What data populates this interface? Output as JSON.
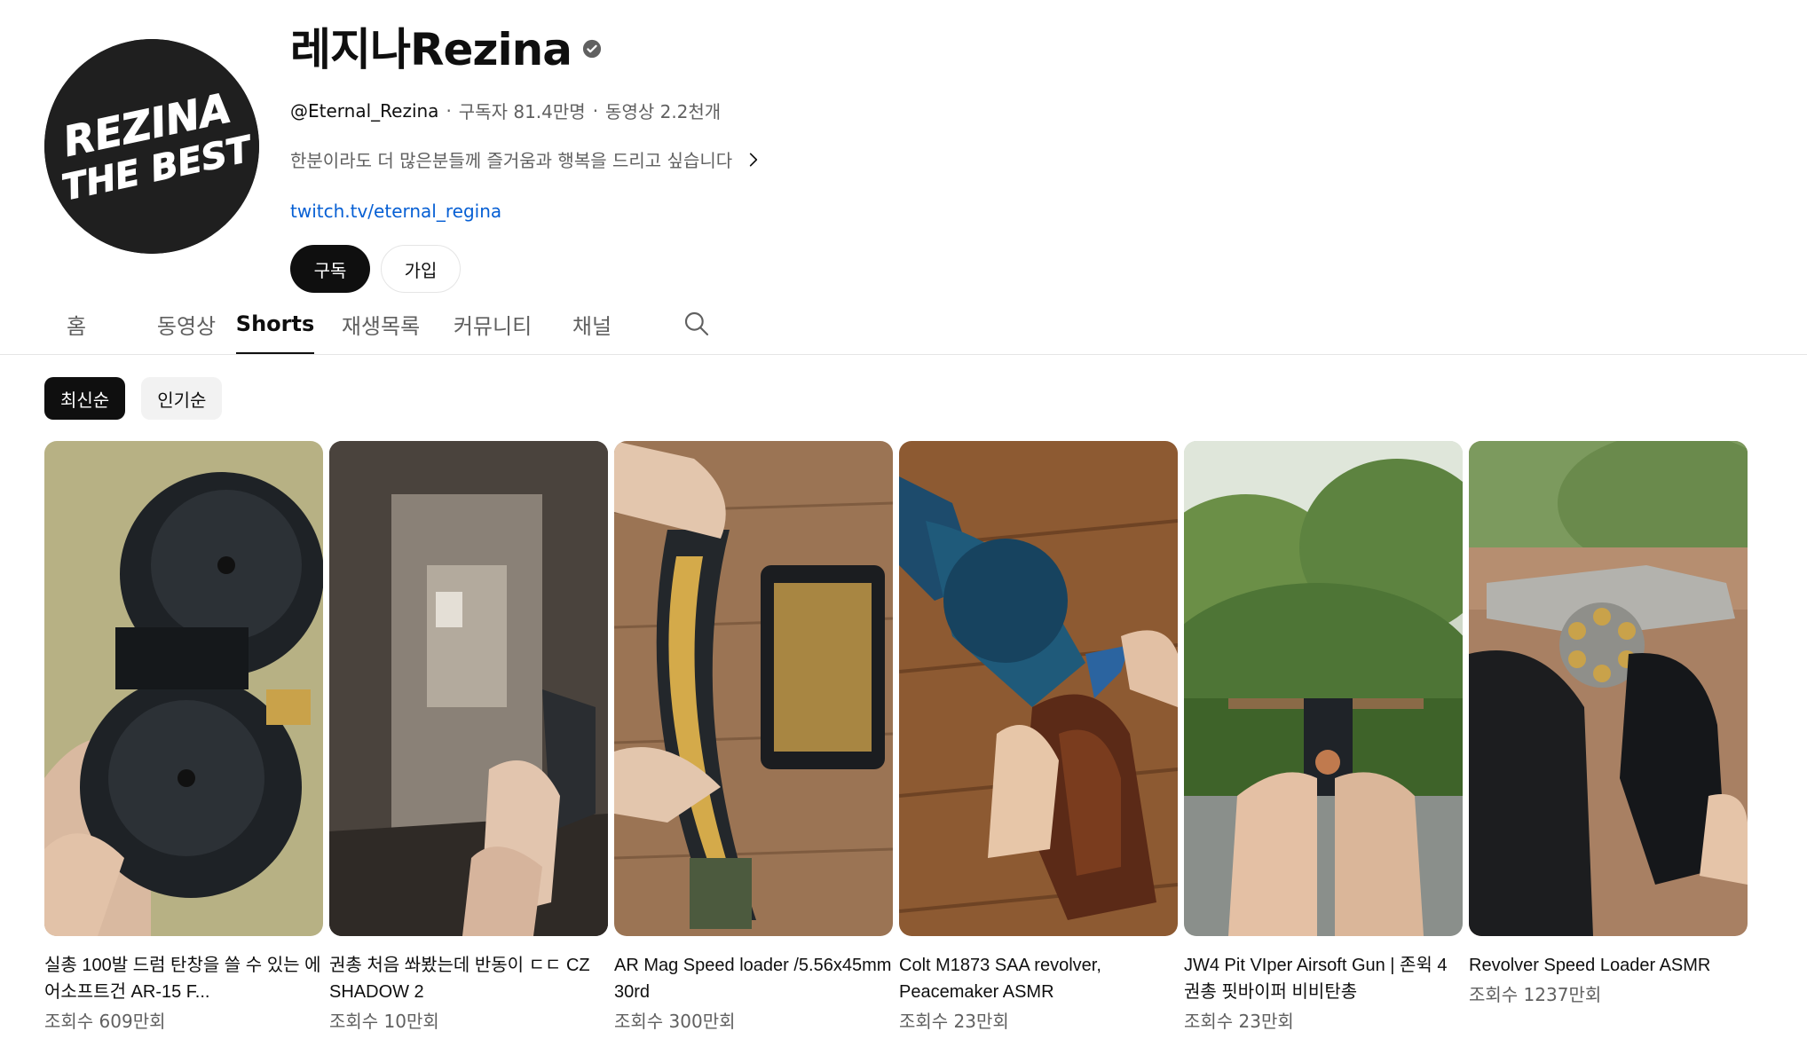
{
  "channel": {
    "name": "레지나Rezina",
    "verified_icon": "verified-check-icon",
    "handle": "@Eternal_Rezina",
    "subscribers": "구독자 81.4만명",
    "video_count": "동영상 2.2천개",
    "separator": "·",
    "description": "한분이라도 더 많은분들께 즐거움과 행복을 드리고 싶습니다",
    "link": "twitch.tv/eternal_regina",
    "avatar_text_line1": "REZINA",
    "avatar_text_line2": "THE BEST"
  },
  "buttons": {
    "subscribe": "구독",
    "join": "가입"
  },
  "tabs": [
    {
      "label": "홈"
    },
    {
      "label": "동영상"
    },
    {
      "label": "Shorts"
    },
    {
      "label": "재생목록"
    },
    {
      "label": "커뮤니티"
    },
    {
      "label": "채널"
    }
  ],
  "active_tab": "Shorts",
  "chips": [
    {
      "label": "최신순"
    },
    {
      "label": "인기순"
    }
  ],
  "shorts": [
    {
      "title": "실총 100발 드럼 탄창을 쓸 수 있는 에어소프트건 AR-15 F...",
      "views": "조회수 609만회"
    },
    {
      "title": "권총 처음 쏴봤는데 반동이 ㄷㄷ CZ SHADOW 2",
      "views": "조회수 10만회"
    },
    {
      "title": "AR Mag Speed loader /5.56x45mm 30rd",
      "views": "조회수 300만회"
    },
    {
      "title": "Colt M1873 SAA revolver, Peacemaker ASMR",
      "views": "조회수 23만회"
    },
    {
      "title": "JW4 Pit VIper Airsoft Gun | 존윅 4 권총 핏바이퍼 비비탄총",
      "views": "조회수 23만회"
    },
    {
      "title": "Revolver Speed Loader ASMR",
      "views": "조회수 1237만회"
    }
  ],
  "colors": {
    "link": "#065fd4",
    "text_primary": "#0f0f0f",
    "text_secondary": "#606060",
    "chip_active_bg": "#0f0f0f",
    "chip_inactive_bg": "#f2f2f2"
  }
}
